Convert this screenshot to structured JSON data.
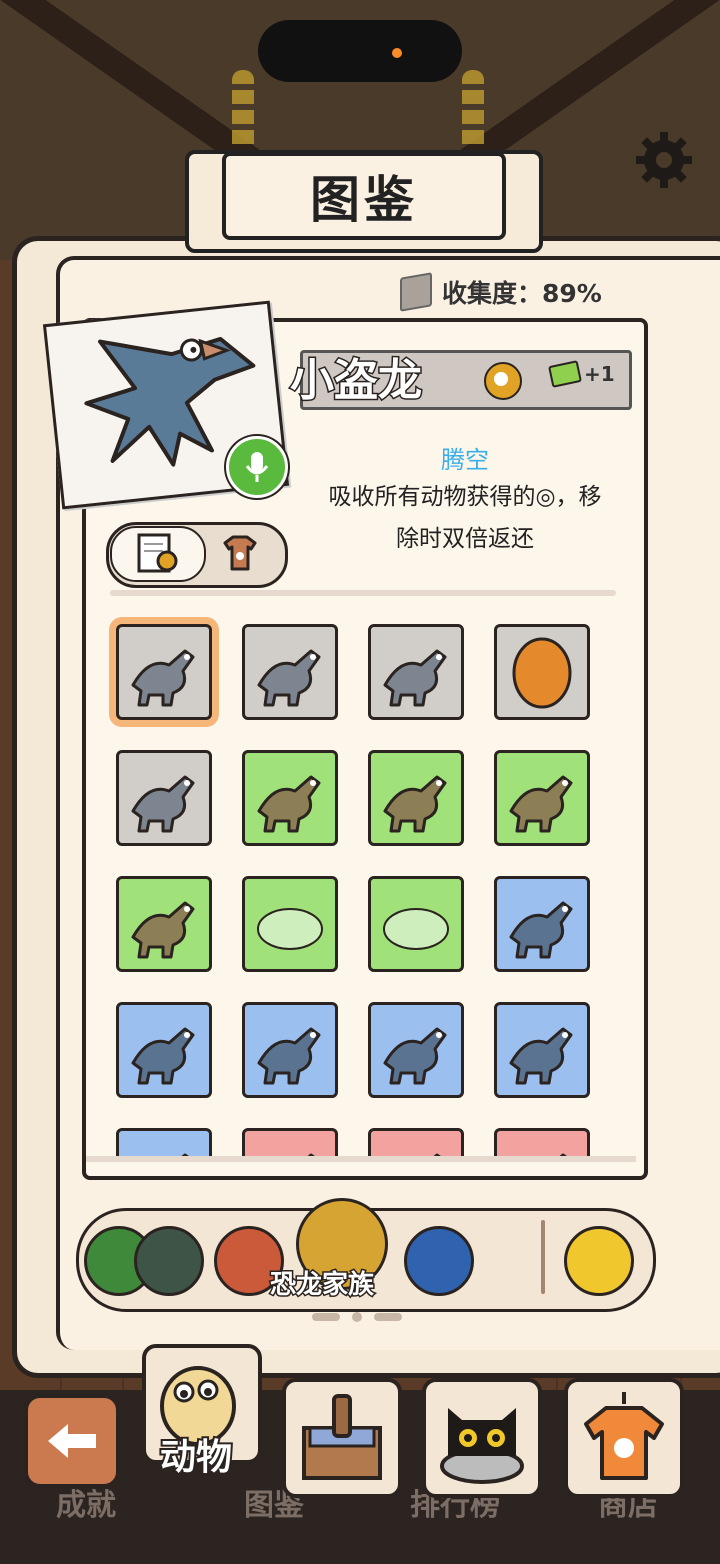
{
  "header": {
    "title": "图鉴"
  },
  "collection": {
    "label": "收集度：",
    "value": "89%"
  },
  "selected_animal": {
    "name": "小盗龙",
    "bonus": "+1",
    "skill_name": "腾空",
    "skill_desc_line1": "吸收所有动物获得的◎，移",
    "skill_desc_line2": "除时双倍返还"
  },
  "colors": {
    "gray": "#d1cdc9",
    "green": "#a1e17a",
    "blue": "#9bbfef",
    "red": "#f2a3a0",
    "accent": "#3aaeea"
  },
  "grid": [
    {
      "color": "gray",
      "icon": "microraptor-icon",
      "selected": true
    },
    {
      "color": "gray",
      "icon": "raptor-icon"
    },
    {
      "color": "gray",
      "icon": "parasaurolophus-icon"
    },
    {
      "color": "gray",
      "icon": "dino-egg-icon"
    },
    {
      "color": "gray",
      "icon": "feathered-dino-icon"
    },
    {
      "color": "green",
      "icon": "triceratops-icon"
    },
    {
      "color": "green",
      "icon": "crested-dino-icon"
    },
    {
      "color": "green",
      "icon": "pink-dino-icon"
    },
    {
      "color": "green",
      "icon": "oviraptor-icon"
    },
    {
      "color": "green",
      "icon": "locked-silhouette-icon"
    },
    {
      "color": "green",
      "icon": "locked-silhouette-icon"
    },
    {
      "color": "blue",
      "icon": "stegosaurus-icon"
    },
    {
      "color": "blue",
      "icon": "dilophosaurus-icon"
    },
    {
      "color": "blue",
      "icon": "therizinosaurus-icon"
    },
    {
      "color": "blue",
      "icon": "brachiosaurus-icon"
    },
    {
      "color": "blue",
      "icon": "pteranodon-icon"
    },
    {
      "color": "blue",
      "icon": "dino-icon"
    },
    {
      "color": "red",
      "icon": "dino-icon"
    },
    {
      "color": "red",
      "icon": "dino-icon"
    },
    {
      "color": "red",
      "icon": "dino-icon"
    }
  ],
  "category": {
    "label": "恐龙家族"
  },
  "tabs": {
    "achievements": "成就",
    "animals": "动物",
    "catalog": "图鉴",
    "ranking": "排行榜",
    "shop": "商店"
  }
}
